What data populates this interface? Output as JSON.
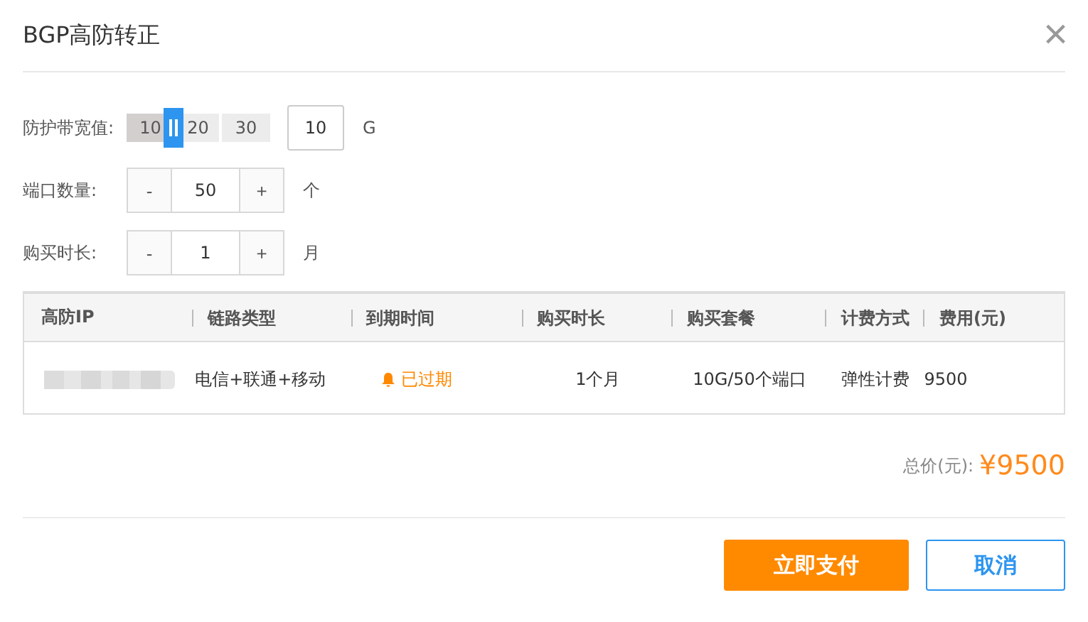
{
  "dialog": {
    "title": "BGP高防转正",
    "close_symbol": "×"
  },
  "bandwidth": {
    "label": "防护带宽值:",
    "ticks": [
      "10",
      "20",
      "30"
    ],
    "level": 0.33,
    "value": "10",
    "unit": "G"
  },
  "steppers": [
    {
      "label": "端口数量:",
      "minus": "-",
      "value": "50",
      "plus": "+",
      "unit": "个"
    },
    {
      "label": "购买时长:",
      "minus": "-",
      "value": "1",
      "plus": "+",
      "unit": "月"
    }
  ],
  "table": {
    "columns": [
      "高防IP",
      "链路类型",
      "到期时间",
      "购买时长",
      "购买套餐",
      "计费方式",
      "费用(元)"
    ],
    "rows": [
      {
        "link": "电信+联通+移动",
        "expiry": "已过期",
        "expired": true,
        "duration": "1个月",
        "package": "10G/50个端口",
        "billing": "弹性计费",
        "fee": "9500"
      }
    ]
  },
  "total": {
    "label": "总价(元):",
    "amount": "¥9500"
  },
  "buttons": [
    {
      "kind": "primary",
      "label": "立即支付"
    },
    {
      "kind": "secondary",
      "label": "取消"
    }
  ]
}
